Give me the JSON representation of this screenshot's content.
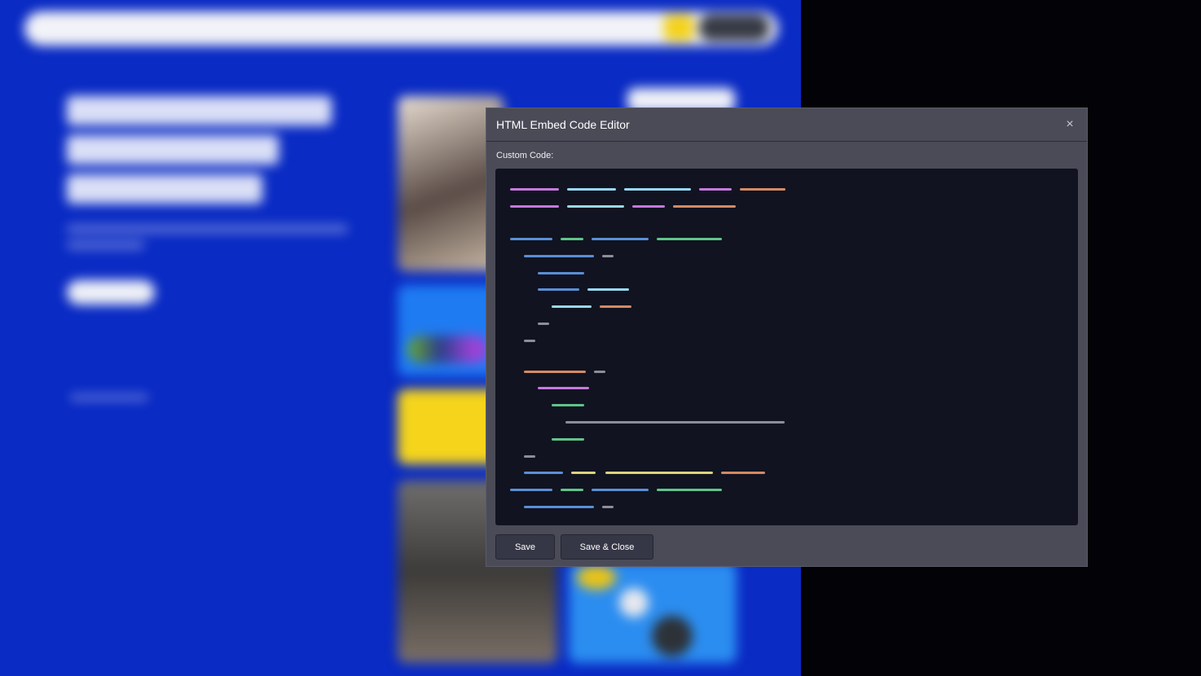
{
  "modal": {
    "title": "HTML Embed Code Editor",
    "close_glyph": "×",
    "field_label": "Custom Code:",
    "save_label": "Save",
    "save_close_label": "Save & Close"
  },
  "code_colors": {
    "purple": "#c678dd",
    "lightblue": "#98d8f0",
    "blue": "#5a8fd6",
    "green": "#5fc48a",
    "orange": "#d48a62",
    "gray": "#8c8e99",
    "yellow": "#dcd37a"
  },
  "background": {
    "site_color": "#0a2bc4",
    "outer_color": "#020207"
  }
}
